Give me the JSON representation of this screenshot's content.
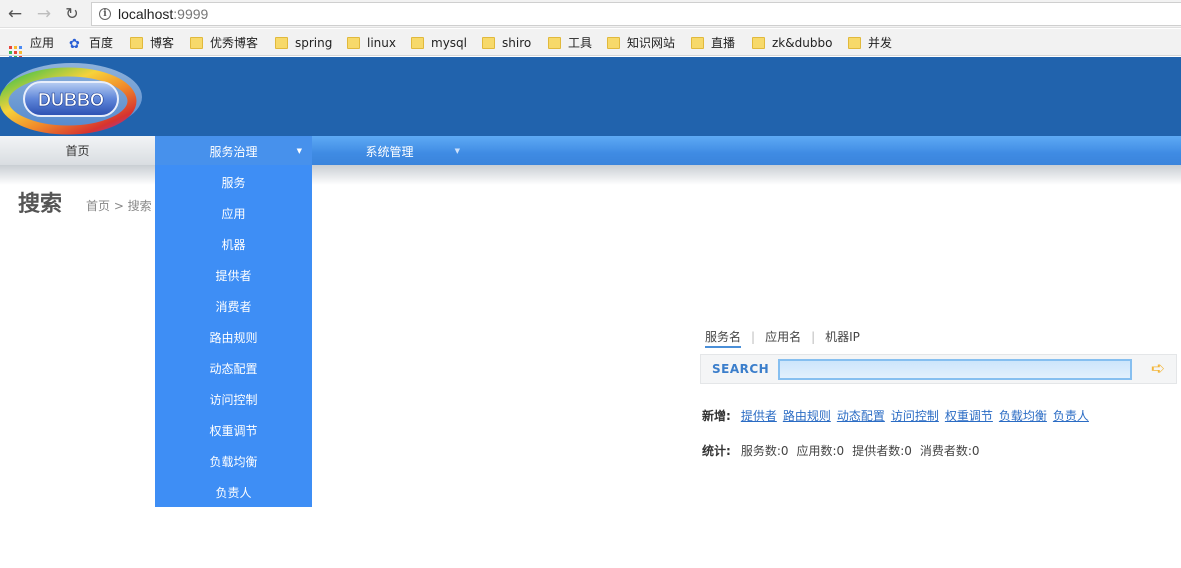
{
  "browser": {
    "url_host": "localhost",
    "url_port": ":9999",
    "bookmarks": [
      {
        "label": "应用",
        "icon": "apps-grid-icon"
      },
      {
        "label": "百度",
        "icon": "baidu-paw-icon"
      },
      {
        "label": "博客",
        "icon": "folder-icon"
      },
      {
        "label": "优秀博客",
        "icon": "folder-icon"
      },
      {
        "label": "spring",
        "icon": "folder-icon"
      },
      {
        "label": "linux",
        "icon": "folder-icon"
      },
      {
        "label": "mysql",
        "icon": "folder-icon"
      },
      {
        "label": "shiro",
        "icon": "folder-icon"
      },
      {
        "label": "工具",
        "icon": "folder-icon"
      },
      {
        "label": "知识网站",
        "icon": "folder-icon"
      },
      {
        "label": "直播",
        "icon": "folder-icon"
      },
      {
        "label": "zk&dubbo",
        "icon": "folder-icon"
      },
      {
        "label": "并发",
        "icon": "folder-icon"
      }
    ]
  },
  "header": {
    "logo_text": "DUBBO",
    "colors": {
      "band": "#2163ad",
      "menu": "#3f8be3",
      "dropdown": "#3e8ef5"
    }
  },
  "menu": {
    "home": "首页",
    "service_governance": "服务治理",
    "system_management": "系统管理"
  },
  "dropdown": {
    "items": [
      "服务",
      "应用",
      "机器",
      "提供者",
      "消费者",
      "路由规则",
      "动态配置",
      "访问控制",
      "权重调节",
      "负载均衡",
      "负责人"
    ]
  },
  "page": {
    "title": "搜索",
    "breadcrumb": "首页 > 搜索"
  },
  "search": {
    "tabs": [
      "服务名",
      "应用名",
      "机器IP"
    ],
    "separator": "|",
    "label": "SEARCH",
    "input_value": "",
    "input_placeholder": ""
  },
  "add": {
    "label": "新增:",
    "links": [
      "提供者",
      "路由规则",
      "动态配置",
      "访问控制",
      "权重调节",
      "负载均衡",
      "负责人"
    ]
  },
  "stats": {
    "label": "统计:",
    "items": [
      "服务数:0",
      "应用数:0",
      "提供者数:0",
      "消费者数:0"
    ]
  }
}
